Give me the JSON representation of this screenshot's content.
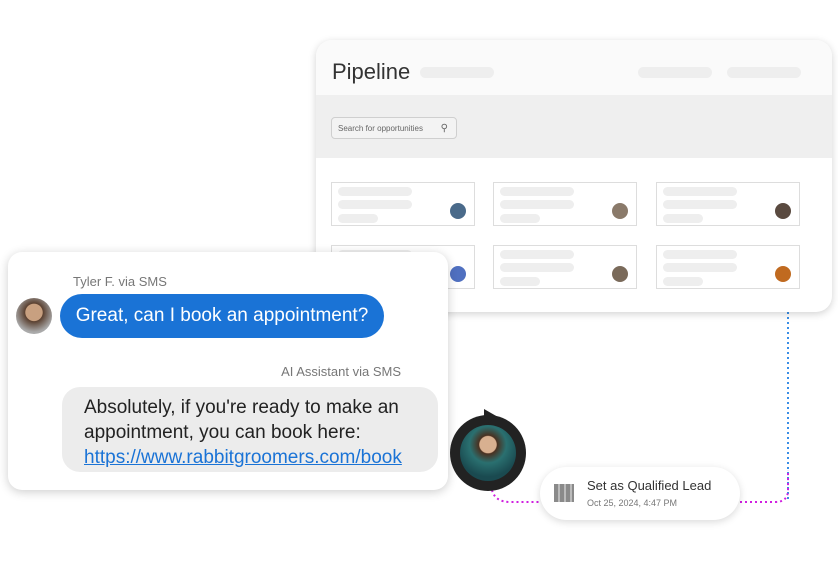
{
  "pipeline": {
    "title": "Pipeline",
    "search_placeholder": "Search for opportunities",
    "search_icon": "search-icon",
    "avatar_colors": [
      "#4a6a8a",
      "#8a7a6a",
      "#5a4a40",
      "#5070c0",
      "#7a6a5a",
      "#c06a20"
    ]
  },
  "chat": {
    "sender1_label": "Tyler F. via SMS",
    "message1": "Great, can I book an appointment?",
    "sender2_label": "AI Assistant via SMS",
    "message2": "Absolutely, if you're ready to make an appointment, you can book here:",
    "link": "https://www.rabbitgroomers.com/book",
    "bubble_color": "#1a73d6"
  },
  "event": {
    "title": "Set as Qualified Lead",
    "timestamp": "Oct 25, 2024, 4:47 PM",
    "icon": "building-icon"
  }
}
